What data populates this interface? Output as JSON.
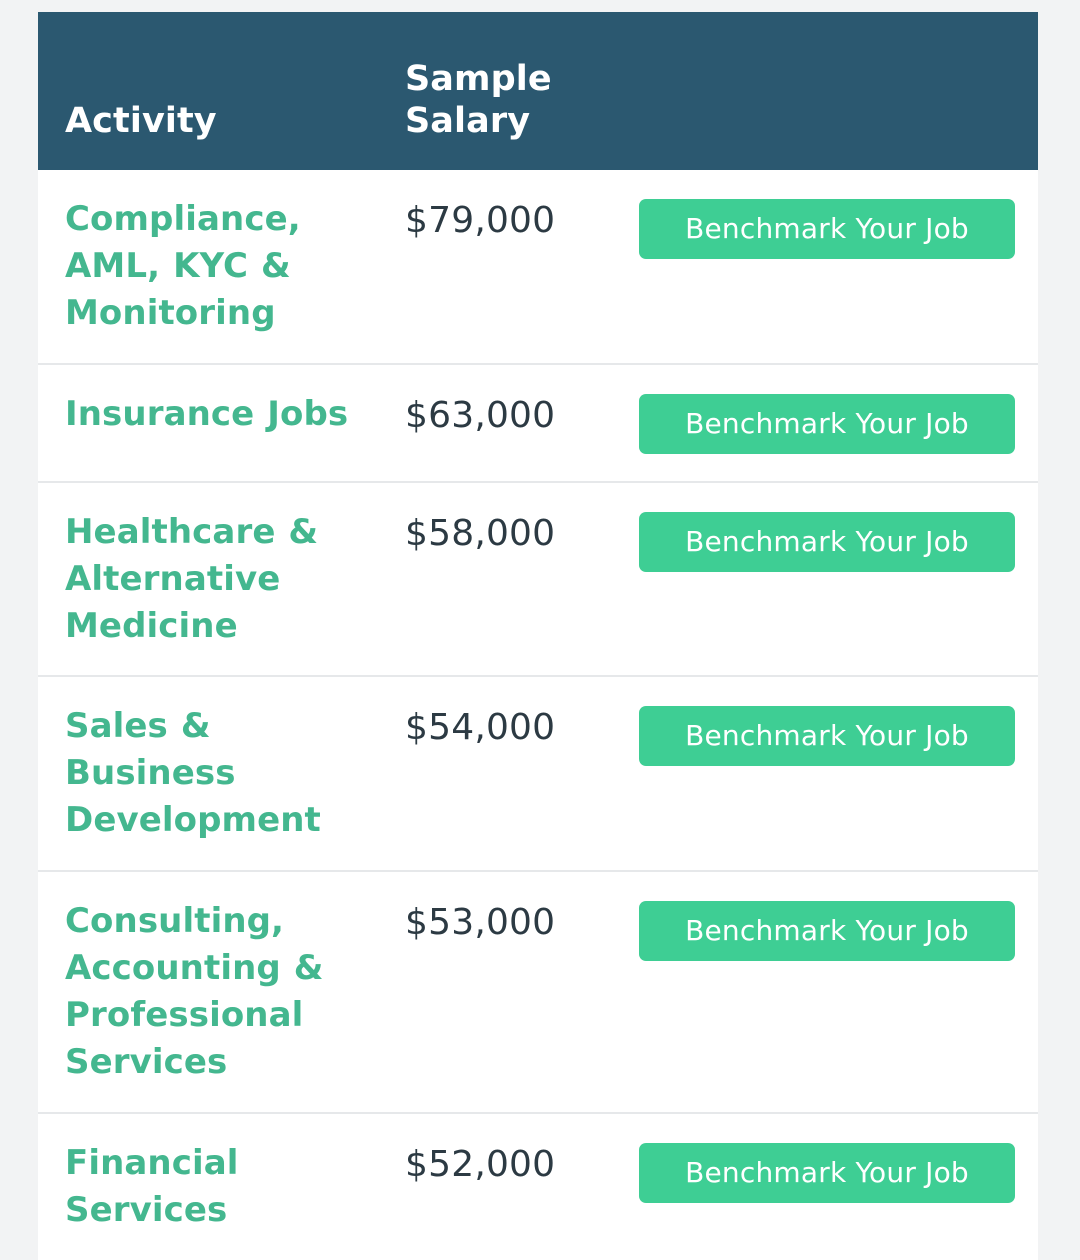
{
  "table": {
    "columns": {
      "activity": "Activity",
      "sample_salary_line1": "Sample",
      "sample_salary_line2": "Salary",
      "sample_salary": "Sample Salary"
    },
    "colors": {
      "header_background": "#2b5870",
      "header_text": "#ffffff",
      "activity_text": "#44b78f",
      "salary_text": "#2c3a43",
      "button_background": "#3ece94",
      "button_text": "#ffffff",
      "row_background": "#ffffff",
      "row_divider": "#e6e8ea",
      "page_background": "#f2f3f4"
    },
    "rows": [
      {
        "activity": "Compliance, AML, KYC & Monitoring",
        "sample_salary": "$79,000",
        "action_label": "Benchmark Your Job"
      },
      {
        "activity": "Insurance Jobs",
        "sample_salary": "$63,000",
        "action_label": "Benchmark Your Job"
      },
      {
        "activity": "Healthcare & Alternative Medicine",
        "sample_salary": "$58,000",
        "action_label": "Benchmark Your Job"
      },
      {
        "activity": "Sales & Business Development",
        "sample_salary": "$54,000",
        "action_label": "Benchmark Your Job"
      },
      {
        "activity": "Consulting, Accounting & Professional Services",
        "sample_salary": "$53,000",
        "action_label": "Benchmark Your Job"
      },
      {
        "activity": "Financial Services",
        "sample_salary": "$52,000",
        "action_label": "Benchmark Your Job"
      }
    ]
  }
}
